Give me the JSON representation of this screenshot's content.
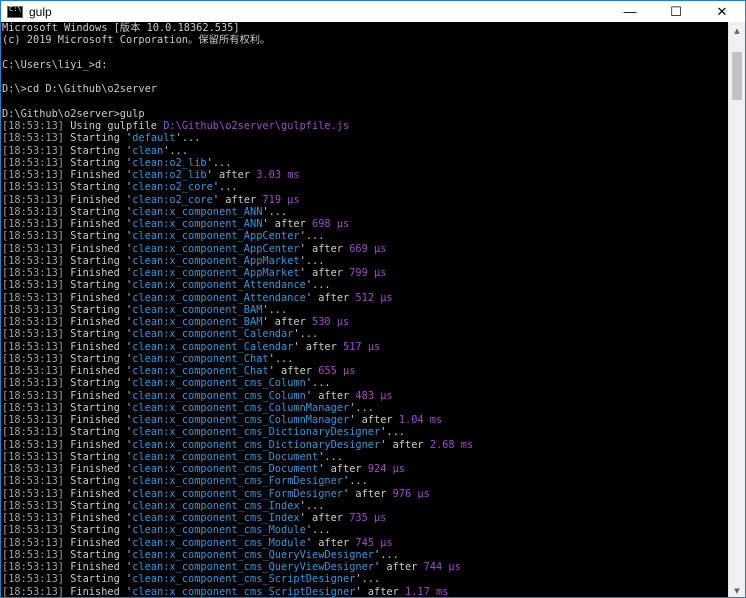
{
  "window": {
    "title": "gulp",
    "minimize_glyph": "—",
    "maximize_glyph": "☐",
    "close_glyph": "✕"
  },
  "scrollbar": {
    "up_glyph": "▲",
    "down_glyph": "▼"
  },
  "header_lines": [
    "Microsoft Windows [版本 10.0.18362.535]",
    "(c) 2019 Microsoft Corporation。保留所有权利。",
    "",
    "C:\\Users\\liyi_>d:",
    "",
    "D:\\>cd D:\\Github\\o2server",
    "",
    "D:\\Github\\o2server>gulp"
  ],
  "gulpfile_line": {
    "time": "[18:53:13]",
    "text": " Using gulpfile ",
    "path": "D:\\Github\\o2server\\gulpfile.js"
  },
  "log": [
    {
      "time": "[18:53:13]",
      "verb": "Starting",
      "task": "default"
    },
    {
      "time": "[18:53:13]",
      "verb": "Starting",
      "task": "clean"
    },
    {
      "time": "[18:53:13]",
      "verb": "Starting",
      "task": "clean:o2_lib"
    },
    {
      "time": "[18:53:13]",
      "verb": "Finished",
      "task": "clean:o2_lib",
      "duration": "3.03 ms"
    },
    {
      "time": "[18:53:13]",
      "verb": "Starting",
      "task": "clean:o2_core"
    },
    {
      "time": "[18:53:13]",
      "verb": "Finished",
      "task": "clean:o2_core",
      "duration": "719 μs"
    },
    {
      "time": "[18:53:13]",
      "verb": "Starting",
      "task": "clean:x_component_ANN"
    },
    {
      "time": "[18:53:13]",
      "verb": "Finished",
      "task": "clean:x_component_ANN",
      "duration": "698 μs"
    },
    {
      "time": "[18:53:13]",
      "verb": "Starting",
      "task": "clean:x_component_AppCenter"
    },
    {
      "time": "[18:53:13]",
      "verb": "Finished",
      "task": "clean:x_component_AppCenter",
      "duration": "669 μs"
    },
    {
      "time": "[18:53:13]",
      "verb": "Starting",
      "task": "clean:x_component_AppMarket"
    },
    {
      "time": "[18:53:13]",
      "verb": "Finished",
      "task": "clean:x_component_AppMarket",
      "duration": "799 μs"
    },
    {
      "time": "[18:53:13]",
      "verb": "Starting",
      "task": "clean:x_component_Attendance"
    },
    {
      "time": "[18:53:13]",
      "verb": "Finished",
      "task": "clean:x_component_Attendance",
      "duration": "512 μs"
    },
    {
      "time": "[18:53:13]",
      "verb": "Starting",
      "task": "clean:x_component_BAM"
    },
    {
      "time": "[18:53:13]",
      "verb": "Finished",
      "task": "clean:x_component_BAM",
      "duration": "530 μs"
    },
    {
      "time": "[18:53:13]",
      "verb": "Starting",
      "task": "clean:x_component_Calendar"
    },
    {
      "time": "[18:53:13]",
      "verb": "Finished",
      "task": "clean:x_component_Calendar",
      "duration": "517 μs"
    },
    {
      "time": "[18:53:13]",
      "verb": "Starting",
      "task": "clean:x_component_Chat"
    },
    {
      "time": "[18:53:13]",
      "verb": "Finished",
      "task": "clean:x_component_Chat",
      "duration": "655 μs"
    },
    {
      "time": "[18:53:13]",
      "verb": "Starting",
      "task": "clean:x_component_cms_Column"
    },
    {
      "time": "[18:53:13]",
      "verb": "Finished",
      "task": "clean:x_component_cms_Column",
      "duration": "483 μs"
    },
    {
      "time": "[18:53:13]",
      "verb": "Starting",
      "task": "clean:x_component_cms_ColumnManager"
    },
    {
      "time": "[18:53:13]",
      "verb": "Finished",
      "task": "clean:x_component_cms_ColumnManager",
      "duration": "1.04 ms"
    },
    {
      "time": "[18:53:13]",
      "verb": "Starting",
      "task": "clean:x_component_cms_DictionaryDesigner"
    },
    {
      "time": "[18:53:13]",
      "verb": "Finished",
      "task": "clean:x_component_cms_DictionaryDesigner",
      "duration": "2.68 ms"
    },
    {
      "time": "[18:53:13]",
      "verb": "Starting",
      "task": "clean:x_component_cms_Document"
    },
    {
      "time": "[18:53:13]",
      "verb": "Finished",
      "task": "clean:x_component_cms_Document",
      "duration": "924 μs"
    },
    {
      "time": "[18:53:13]",
      "verb": "Starting",
      "task": "clean:x_component_cms_FormDesigner"
    },
    {
      "time": "[18:53:13]",
      "verb": "Finished",
      "task": "clean:x_component_cms_FormDesigner",
      "duration": "976 μs"
    },
    {
      "time": "[18:53:13]",
      "verb": "Starting",
      "task": "clean:x_component_cms_Index"
    },
    {
      "time": "[18:53:13]",
      "verb": "Finished",
      "task": "clean:x_component_cms_Index",
      "duration": "735 μs"
    },
    {
      "time": "[18:53:13]",
      "verb": "Starting",
      "task": "clean:x_component_cms_Module"
    },
    {
      "time": "[18:53:13]",
      "verb": "Finished",
      "task": "clean:x_component_cms_Module",
      "duration": "745 μs"
    },
    {
      "time": "[18:53:13]",
      "verb": "Starting",
      "task": "clean:x_component_cms_QueryViewDesigner"
    },
    {
      "time": "[18:53:13]",
      "verb": "Finished",
      "task": "clean:x_component_cms_QueryViewDesigner",
      "duration": "744 μs"
    },
    {
      "time": "[18:53:13]",
      "verb": "Starting",
      "task": "clean:x_component_cms_ScriptDesigner"
    },
    {
      "time": "[18:53:13]",
      "verb": "Finished",
      "task": "clean:x_component_cms_ScriptDesigner",
      "duration": "1.17 ms"
    }
  ],
  "colors": {
    "timestamp": "#a4a4a4",
    "task": "#3a96dd",
    "duration": "#a24cc8",
    "text": "#cccccc"
  }
}
